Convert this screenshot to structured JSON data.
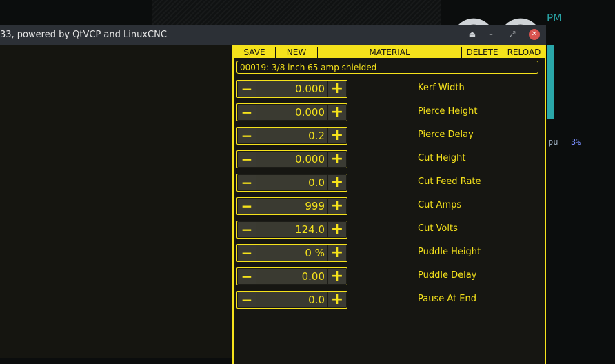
{
  "window": {
    "title": "33, powered by QtVCP and LinuxCNC",
    "buttons": {
      "shade": "⏏",
      "minimize": "–",
      "maximize": "⤢",
      "close": "✕"
    }
  },
  "desktop": {
    "pm": "PM",
    "cpu_label": "pu",
    "cpu_value": "3%"
  },
  "toolbar": {
    "save": "SAVE",
    "new": "NEW",
    "material": "MATERIAL",
    "delete": "DELETE",
    "reload": "RELOAD"
  },
  "material_selected": "00019: 3/8 inch 65 amp shielded",
  "params": [
    {
      "label": "Kerf Width",
      "value": "0.000"
    },
    {
      "label": "Pierce Height",
      "value": "0.000"
    },
    {
      "label": "Pierce Delay",
      "value": "0.2"
    },
    {
      "label": "Cut Height",
      "value": "0.000"
    },
    {
      "label": "Cut Feed Rate",
      "value": "0.0"
    },
    {
      "label": "Cut Amps",
      "value": "999"
    },
    {
      "label": "Cut Volts",
      "value": "124.0"
    },
    {
      "label": "Puddle Height",
      "value": "0 %"
    },
    {
      "label": "Puddle Delay",
      "value": "0.00"
    },
    {
      "label": "Pause At End",
      "value": "0.0"
    }
  ],
  "spin_symbols": {
    "minus": "−",
    "plus": "+"
  },
  "colors": {
    "accent": "#f5e21b",
    "panel_bg": "#161612",
    "titlebar": "#2c3036",
    "close": "#d9534f",
    "teal": "#2aa7a9"
  }
}
